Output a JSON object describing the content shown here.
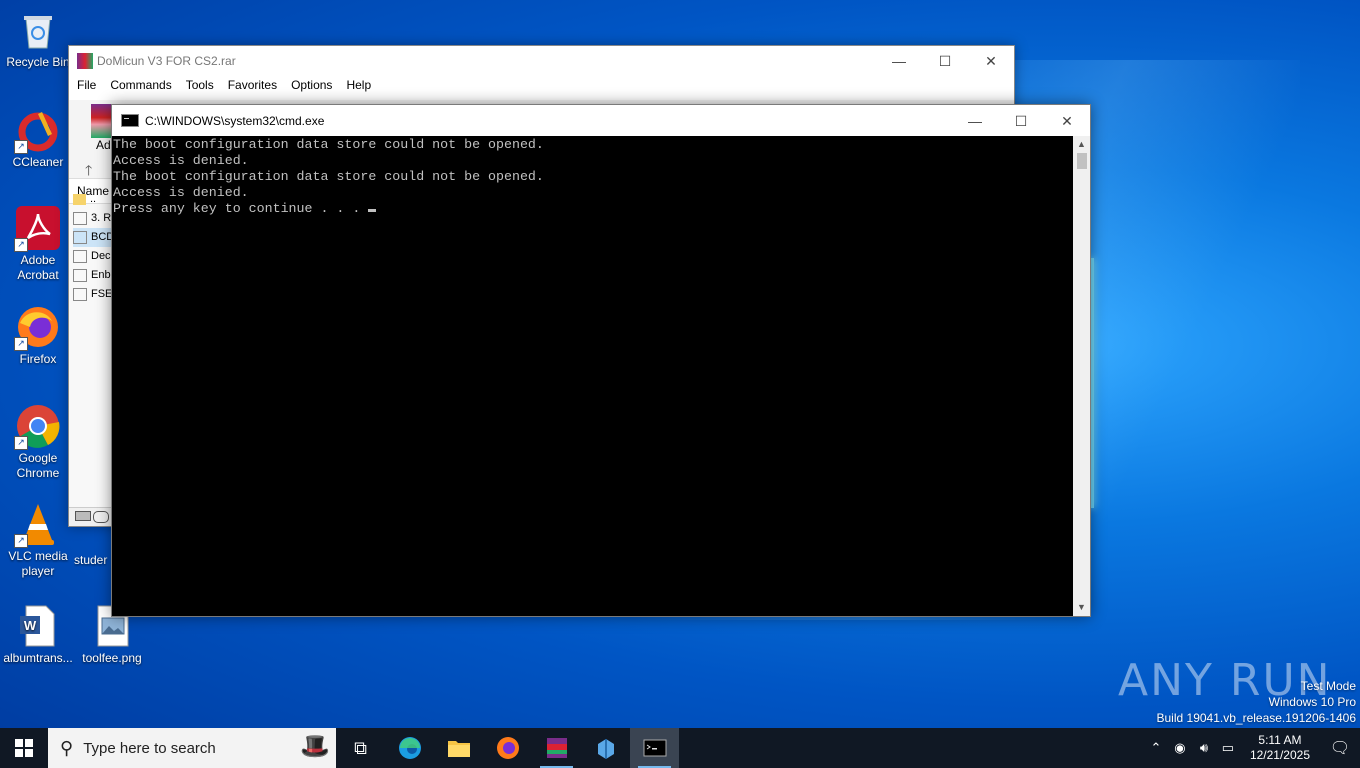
{
  "desktop": {
    "icons": [
      {
        "label": "Recycle Bin"
      },
      {
        "label": "CCleaner"
      },
      {
        "label": "Adobe Acrobat"
      },
      {
        "label": "Firefox"
      },
      {
        "label": "Google Chrome"
      },
      {
        "label": "VLC media player"
      },
      {
        "label": "albumtrans..."
      },
      {
        "label": "toolfee.png"
      },
      {
        "label": "studer"
      }
    ]
  },
  "winrar": {
    "title": "DoMicun V3 FOR CS2.rar",
    "menu": [
      "File",
      "Commands",
      "Tools",
      "Favorites",
      "Options",
      "Help"
    ],
    "toolbar_first_label": "Ad",
    "column_name": "Name",
    "files": [
      "..",
      "3. R",
      "BCD",
      "Dec",
      "Enb",
      "FSE"
    ]
  },
  "cmd": {
    "title": "C:\\WINDOWS\\system32\\cmd.exe",
    "lines": [
      "The boot configuration data store could not be opened.",
      "Access is denied.",
      "The boot configuration data store could not be opened.",
      "Access is denied.",
      "Press any key to continue . . ."
    ]
  },
  "watermark": {
    "brand": "ANY RUN",
    "mode": "Test Mode",
    "edition": "Windows 10 Pro",
    "build": "Build 19041.vb_release.191206-1406"
  },
  "taskbar": {
    "search_placeholder": "Type here to search",
    "time": "5:11 AM",
    "date": "12/21/2025"
  },
  "colors": {
    "console_bg": "#000000",
    "console_fg": "#c0c0c0",
    "taskbar_bg": "#101824"
  }
}
